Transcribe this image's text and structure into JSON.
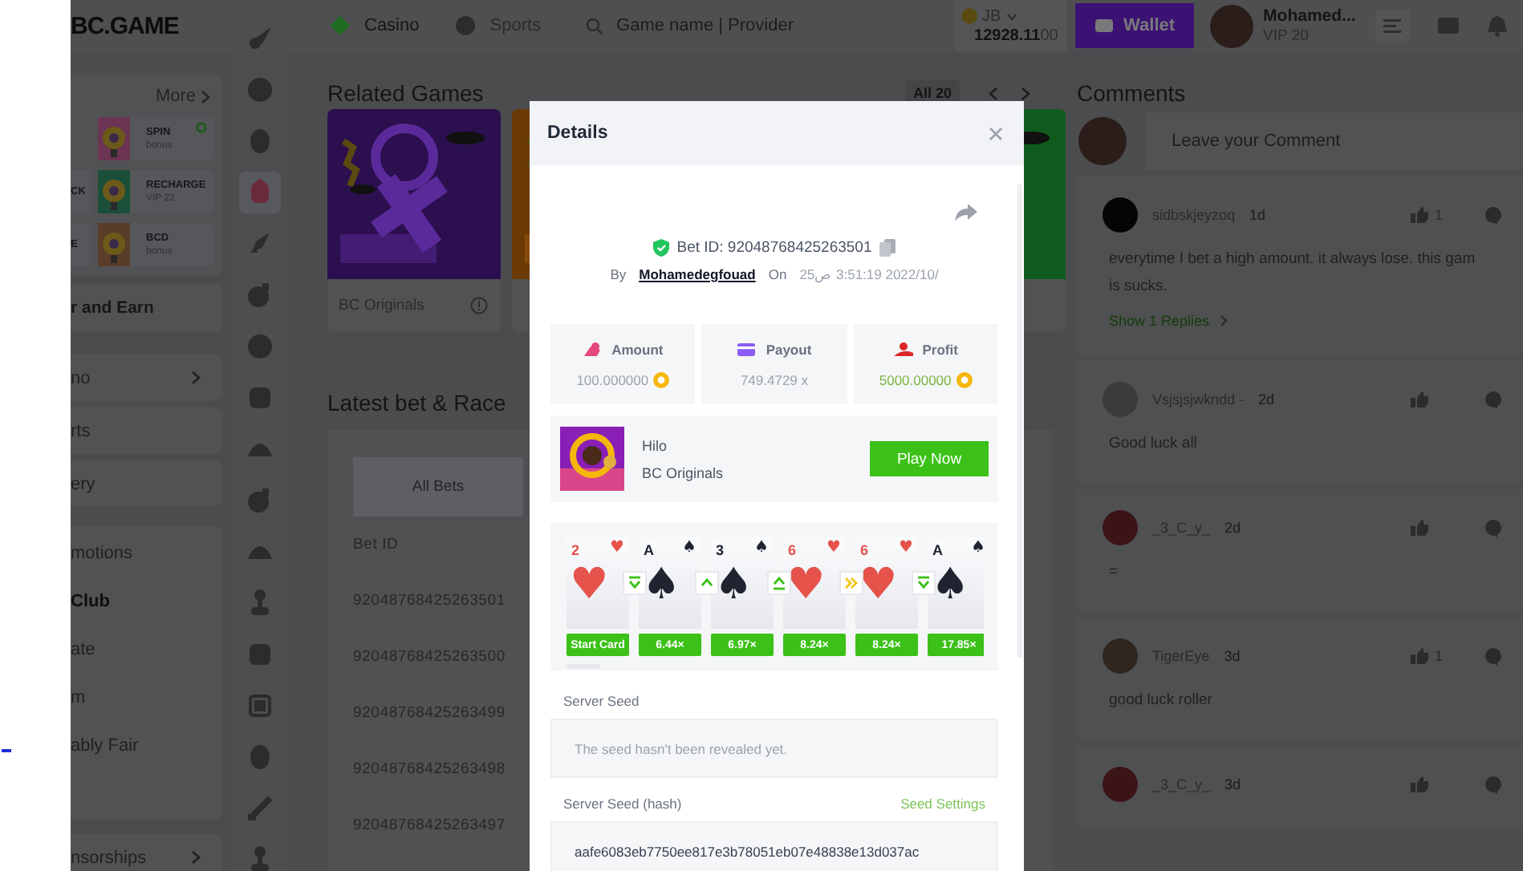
{
  "topbar": {
    "logo": "BC.GAME",
    "tabs": [
      {
        "label": "Casino",
        "selected": true
      },
      {
        "label": "Sports",
        "selected": false
      }
    ],
    "search": {
      "placeholder": "Game name | Provider"
    },
    "currency": "JB",
    "balance": "**12928.11**00",
    "wallet": "Wallet",
    "user": {
      "name": "Mohamed...",
      "vip": "VIP 20"
    }
  },
  "sidebar": {
    "more": "More",
    "promos": [
      {
        "title": "SPIN",
        "subtitle": "bonus"
      },
      {
        "left": "CK",
        "title": "RECHARGE",
        "subtitle": "VIP 22"
      },
      {
        "left": "E",
        "title": "BCD",
        "subtitle": "bonus"
      }
    ],
    "earn": "r and Earn",
    "menu": [
      {
        "label": "no",
        "expandable": true
      },
      {
        "label": "rts",
        "expandable": false
      },
      {
        "label": "ery",
        "expandable": false
      }
    ],
    "group": [
      {
        "label": "motions",
        "emphasized": false
      },
      {
        "label": "Club",
        "emphasized": true
      },
      {
        "label": "ate",
        "emphasized": false
      },
      {
        "label": "m",
        "emphasized": false
      },
      {
        "label": "ably Fair",
        "emphasized": false
      }
    ],
    "sponsorships": "nsorships"
  },
  "rail": [
    {
      "selected": false
    },
    {
      "selected": false
    },
    {
      "selected": false
    },
    {
      "selected": true
    },
    {
      "selected": false
    },
    {
      "selected": false
    },
    {
      "selected": false
    },
    {
      "selected": false
    },
    {
      "selected": false
    },
    {
      "selected": false
    },
    {
      "selected": false
    },
    {
      "selected": false
    },
    {
      "selected": false
    },
    {
      "selected": false
    },
    {
      "selected": false
    },
    {
      "selected": false
    },
    {
      "selected": false
    }
  ],
  "related": {
    "title": "Related Games",
    "count": "All 20",
    "games": [
      {
        "kind": "picture",
        "provider": "BC Originals"
      },
      {
        "kind": "picture"
      },
      {
        "kind": "picture"
      }
    ]
  },
  "latest": {
    "title": "Latest bet & Race",
    "tabs": [
      {
        "label": "All Bets",
        "selected": true
      }
    ],
    "column": "Bet ID",
    "rows": [
      "92048768425263501",
      "92048768425263500",
      "92048768425263499",
      "92048768425263498",
      "92048768425263497"
    ]
  },
  "comments": {
    "title": "Comments",
    "placeholder": "Leave your Comment",
    "items": [
      {
        "user": "sidbskjeyzoq",
        "time": "1d",
        "likes": "1",
        "lines": [
          "everytime I bet a high amount. it always lose. this gam",
          "is sucks."
        ],
        "replies": "Show 1 Replies"
      },
      {
        "user": "Vsjsjsjwkndd -",
        "time": "2d",
        "lines": [
          "Good luck all"
        ]
      },
      {
        "user": "_3_C_y_",
        "time": "2d",
        "lines": [
          "="
        ]
      },
      {
        "user": "TigerEye",
        "time": "3d",
        "likes": "1",
        "lines": [
          "good luck roller"
        ]
      },
      {
        "user": "_3_C_y_",
        "time": "3d"
      }
    ]
  },
  "modal": {
    "title": "Details",
    "bet_id": "Bet ID: 92048768425263501",
    "by": "By",
    "user": "Mohamedegfouad",
    "on": "On",
    "date": "25ص 3:51:19 2022/10/",
    "stats": [
      {
        "kind": "amount",
        "label": "Amount",
        "value": "100.000000",
        "coin": true
      },
      {
        "kind": "payout",
        "label": "Payout",
        "value": "749.4729 x",
        "coin": false
      },
      {
        "kind": "profit",
        "label": "Profit",
        "value": "5000.00000",
        "coin": true
      }
    ],
    "game": {
      "name": "Hilo",
      "provider": "BC Originals",
      "play": "Play Now"
    },
    "rounds": [
      {
        "rank": "2",
        "suit": "♥",
        "red": true,
        "tag": "Start Card",
        "kind": "lower_equal"
      },
      {
        "rank": "A",
        "suit": "♠",
        "red": false,
        "tag": "6.44×",
        "kind": "higher"
      },
      {
        "rank": "3",
        "suit": "♠",
        "red": false,
        "tag": "6.97×",
        "kind": "higher_equal"
      },
      {
        "rank": "6",
        "suit": "♥",
        "red": true,
        "tag": "8.24×",
        "kind": "skip"
      },
      {
        "rank": "6",
        "suit": "♥",
        "red": true,
        "tag": "8.24×",
        "kind": "lower_equal"
      },
      {
        "rank": "A",
        "suit": "♠",
        "red": false,
        "tag": "17.85×"
      }
    ],
    "server_seed": {
      "label": "Server Seed",
      "placeholder": "The seed hasn't been revealed yet."
    },
    "hash": {
      "label": "Server Seed (hash)",
      "link": "Seed Settings",
      "value": "aafe6083eb7750ee817e3b78051eb07e48838e13d037ac"
    }
  }
}
